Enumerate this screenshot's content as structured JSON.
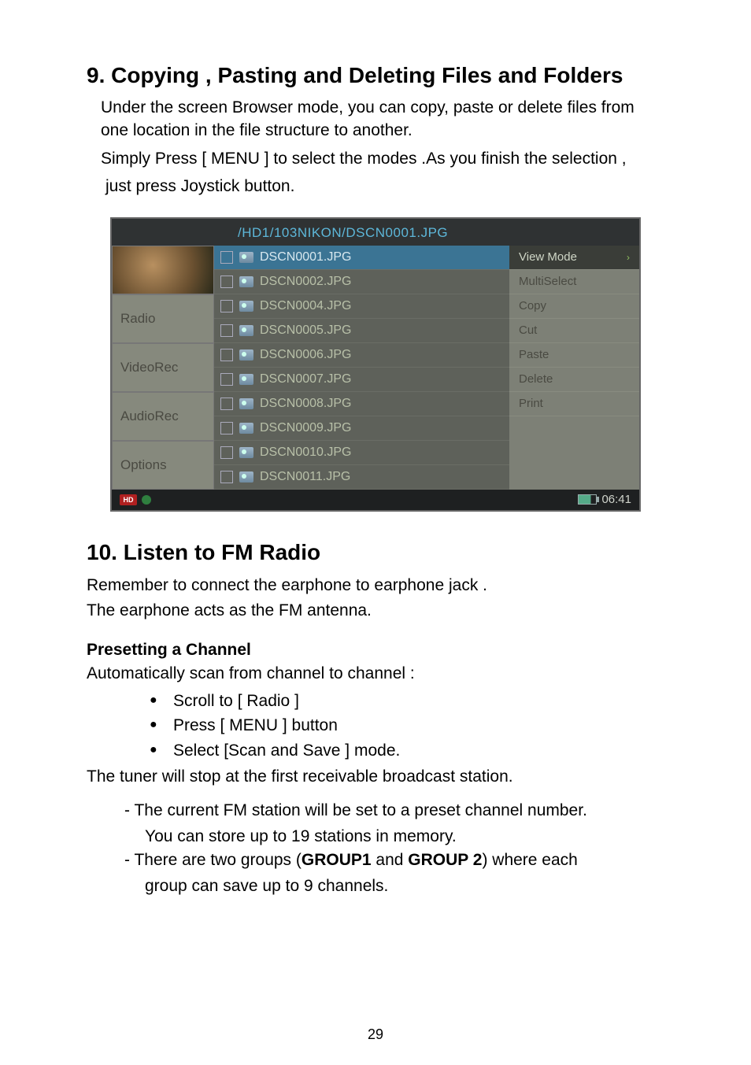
{
  "heading1": "9. Copying , Pasting and Deleting Files and Folders",
  "para1a": "Under the screen Browser mode, you can copy, paste or delete files from one location in the file structure to another.",
  "para1b": "Simply Press [ MENU ] to select the modes .As you finish the selection ,",
  "para1c": " just press Joystick button.",
  "screenshot": {
    "path": "/HD1/103NIKON/DSCN0001.JPG",
    "left_items": [
      "Radio",
      "VideoRec",
      "AudioRec",
      "Options"
    ],
    "files": [
      "DSCN0001.JPG",
      "DSCN0002.JPG",
      "DSCN0004.JPG",
      "DSCN0005.JPG",
      "DSCN0006.JPG",
      "DSCN0007.JPG",
      "DSCN0008.JPG",
      "DSCN0009.JPG",
      "DSCN0010.JPG",
      "DSCN0011.JPG"
    ],
    "menu": [
      "View Mode",
      "MultiSelect",
      "Copy",
      "Cut",
      "Paste",
      "Delete",
      "Print"
    ],
    "hd_label": "HD",
    "time": "06:41"
  },
  "heading2": "10. Listen to FM Radio",
  "para2a": "Remember to connect the earphone to earphone jack .",
  "para2b": "The earphone acts as the FM antenna.",
  "subhead": "Presetting a Channel",
  "para3": "Automatically scan from channel to channel :",
  "bullets": [
    "Scroll to [ Radio ]",
    "Press [ MENU ] button",
    "Select [Scan and Save ] mode."
  ],
  "para4": "The tuner will stop at the first receivable broadcast station.",
  "dash1": "- The current FM station will be set to a preset channel number.",
  "dash1b": "You can store up to 19 stations in memory.",
  "dash2_pre": "- There are two groups (",
  "dash2_g1": "GROUP1",
  "dash2_mid": " and ",
  "dash2_g2": "GROUP 2",
  "dash2_post": ") where each",
  "dash2b": "group can save up to 9 channels.",
  "page_number": "29"
}
